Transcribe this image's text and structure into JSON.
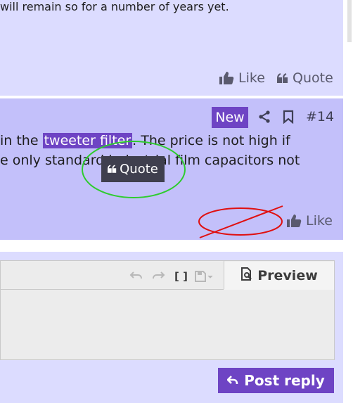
{
  "post1": {
    "text": "will remain so for a number of years yet.",
    "like_label": "Like",
    "quote_label": "Quote"
  },
  "post2": {
    "badge": "New",
    "post_number": "#14",
    "line1_before": " in the ",
    "line1_highlight": "tweeter filter",
    "line1_after": ". The price is not high if",
    "line2": "e only standard industrial film capacitors not",
    "quote_tooltip_label": "Quote",
    "like_label": "Like"
  },
  "editor": {
    "undo_icon": "undo-icon",
    "redo_icon": "redo-icon",
    "brackets_label": "[ ]",
    "save_icon": "save-draft-icon",
    "preview_label": "Preview",
    "post_reply_label": "Post reply"
  },
  "colors": {
    "accent": "#6e44c4",
    "post_bg_light": "#dcdcff",
    "post_bg_highlight": "#c3c0fa",
    "annotation_green": "#2ecc2e",
    "annotation_red": "#e01010"
  }
}
